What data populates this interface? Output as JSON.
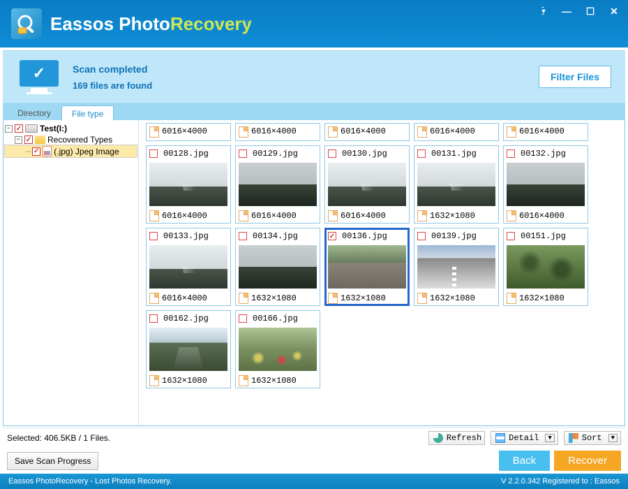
{
  "brand": {
    "part1": "Eassos Photo",
    "part2": "Recovery"
  },
  "window_controls": {
    "dropdown": "▾",
    "minimize": "—",
    "maximize": "☐",
    "close": "✕"
  },
  "status": {
    "title": "Scan completed",
    "subtitle": "169 files are found",
    "filter_btn": "Filter Files"
  },
  "tabs": {
    "directory": "Directory",
    "file_type": "File type"
  },
  "tree": {
    "node0": {
      "label": "Test(I:)"
    },
    "node1": {
      "label": "Recovered Types"
    },
    "node2": {
      "label": "(.jpg) Jpeg Image"
    }
  },
  "partial_row_dim": "6016×4000",
  "thumbs": [
    {
      "name": "00128.jpg",
      "dim": "6016×4000",
      "scene": "scene-mountain",
      "checked": false,
      "selected": false
    },
    {
      "name": "00129.jpg",
      "dim": "6016×4000",
      "scene": "scene-dark-mountain",
      "checked": false,
      "selected": false
    },
    {
      "name": "00130.jpg",
      "dim": "6016×4000",
      "scene": "scene-mountain",
      "checked": false,
      "selected": false
    },
    {
      "name": "00131.jpg",
      "dim": "1632×1080",
      "scene": "scene-mountain",
      "checked": false,
      "selected": false
    },
    {
      "name": "00132.jpg",
      "dim": "6016×4000",
      "scene": "scene-dark-mountain",
      "checked": false,
      "selected": false
    },
    {
      "name": "00133.jpg",
      "dim": "6016×4000",
      "scene": "scene-mountain",
      "checked": false,
      "selected": false
    },
    {
      "name": "00134.jpg",
      "dim": "1632×1080",
      "scene": "scene-dark-mountain",
      "checked": false,
      "selected": false
    },
    {
      "name": "00136.jpg",
      "dim": "1632×1080",
      "scene": "scene-wall",
      "checked": true,
      "selected": true
    },
    {
      "name": "00139.jpg",
      "dim": "1632×1080",
      "scene": "scene-road",
      "checked": false,
      "selected": false
    },
    {
      "name": "00151.jpg",
      "dim": "1632×1080",
      "scene": "scene-forest",
      "checked": false,
      "selected": false
    },
    {
      "name": "00162.jpg",
      "dim": "1632×1080",
      "scene": "scene-valley",
      "checked": false,
      "selected": false
    },
    {
      "name": "00166.jpg",
      "dim": "1632×1080",
      "scene": "scene-garden",
      "checked": false,
      "selected": false
    }
  ],
  "actionbar": {
    "selected_info": "Selected: 406.5KB / 1 Files.",
    "refresh": "Refresh",
    "detail": "Detail",
    "sort": "Sort",
    "save_progress": "Save Scan Progress",
    "back": "Back",
    "recover": "Recover"
  },
  "footer": {
    "left": "Eassos PhotoRecovery - Lost Photos Recovery.",
    "right": "V 2.2.0.342  Registered to : Eassos"
  }
}
